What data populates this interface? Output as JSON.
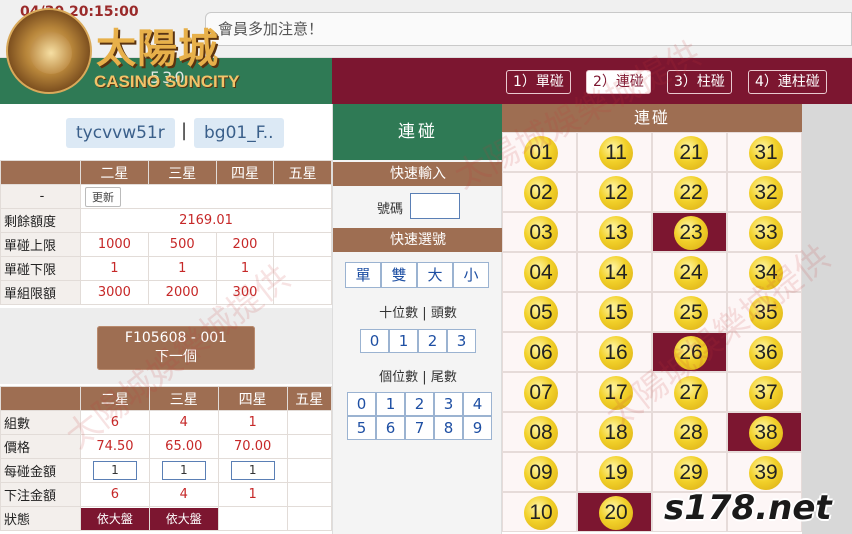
{
  "header": {
    "clock": "04/30 20:15:00",
    "marquee": "會員多加注意！",
    "logo_cn": "太陽城",
    "logo_en": "CASINO SUNCITY",
    "left_number": "530"
  },
  "tabs": [
    "1）單碰",
    "2）連碰",
    "3）柱碰",
    "4）連柱碰"
  ],
  "active_tab": 1,
  "user": {
    "account": "tycvvw51r",
    "separator": "|",
    "game_id": "bg01_F.."
  },
  "limits": {
    "headers": [
      "",
      "二星",
      "三星",
      "四星",
      "五星"
    ],
    "row_dash": "-",
    "update_label": "更新",
    "balance_label": "剩餘額度",
    "balance": "2169.01",
    "rows": [
      {
        "label": "單碰上限",
        "values": [
          "1000",
          "500",
          "200",
          ""
        ]
      },
      {
        "label": "單碰下限",
        "values": [
          "1",
          "1",
          "1",
          ""
        ]
      },
      {
        "label": "單組限額",
        "values": [
          "3000",
          "2000",
          "300",
          ""
        ]
      }
    ]
  },
  "next_button": {
    "line1": "F105608 - 001",
    "line2": "下一個"
  },
  "bet": {
    "headers": [
      "",
      "二星",
      "三星",
      "四星",
      "五星"
    ],
    "group_label": "組數",
    "groups": [
      "6",
      "4",
      "1",
      ""
    ],
    "price_label": "價格",
    "prices": [
      "74.50",
      "65.00",
      "70.00",
      ""
    ],
    "each_label": "每碰金額",
    "each": [
      "1",
      "1",
      "1"
    ],
    "total_label": "下注金額",
    "totals": [
      "6",
      "4",
      "1",
      ""
    ],
    "status_label": "狀態",
    "status": [
      "依大盤",
      "依大盤"
    ]
  },
  "mid": {
    "title": "連碰",
    "quick_input": "快速輸入",
    "number_label": "號碼",
    "quick_select": "快速選號",
    "quick_buttons": [
      "單",
      "雙",
      "大",
      "小"
    ],
    "tens_caption": "十位數 | 頭數",
    "tens_buttons": [
      "0",
      "1",
      "2",
      "3"
    ],
    "units_caption": "個位數 | 尾數",
    "units_row1": [
      "0",
      "1",
      "2",
      "3",
      "4"
    ],
    "units_row2": [
      "5",
      "6",
      "7",
      "8",
      "9"
    ]
  },
  "grid": {
    "title": "連碰",
    "rows": [
      [
        "01",
        "11",
        "21",
        "31"
      ],
      [
        "02",
        "12",
        "22",
        "32"
      ],
      [
        "03",
        "13",
        "23",
        "33"
      ],
      [
        "04",
        "14",
        "24",
        "34"
      ],
      [
        "05",
        "15",
        "25",
        "35"
      ],
      [
        "06",
        "16",
        "26",
        "36"
      ],
      [
        "07",
        "17",
        "27",
        "37"
      ],
      [
        "08",
        "18",
        "28",
        "38"
      ],
      [
        "09",
        "19",
        "29",
        "39"
      ],
      [
        "10",
        "20",
        "",
        ""
      ]
    ],
    "selected": [
      "23",
      "26",
      "38",
      "20"
    ]
  },
  "watermark_site": "s178.net",
  "watermark_text": "太陽城娛樂城提供",
  "colors": {
    "green": "#2f7a55",
    "maroon": "#7c1630",
    "brown": "#9e6e52",
    "ball": "#f2d12a"
  }
}
